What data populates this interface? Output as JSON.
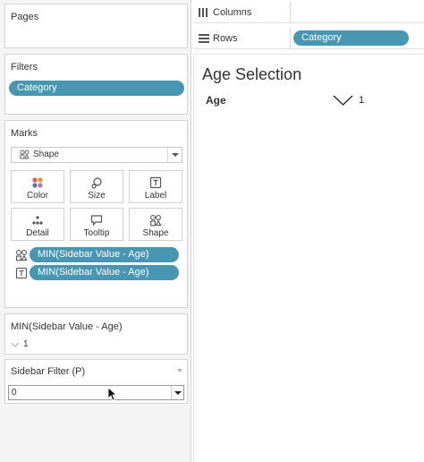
{
  "pages": {
    "title": "Pages"
  },
  "filters": {
    "title": "Filters",
    "items": [
      "Category"
    ]
  },
  "marks": {
    "title": "Marks",
    "mark_type": "Shape",
    "buttons": [
      {
        "label": "Color",
        "icon": "color-icon"
      },
      {
        "label": "Size",
        "icon": "size-icon"
      },
      {
        "label": "Label",
        "icon": "label-icon"
      },
      {
        "label": "Detail",
        "icon": "detail-icon"
      },
      {
        "label": "Tooltip",
        "icon": "tooltip-icon"
      },
      {
        "label": "Shape",
        "icon": "shape-icon"
      }
    ],
    "encodings": [
      {
        "type": "shape",
        "field": "MIN(Sidebar Value - Age)"
      },
      {
        "type": "label",
        "field": "MIN(Sidebar Value - Age)"
      }
    ]
  },
  "shape_legend": {
    "title": "MIN(Sidebar Value - Age)",
    "items": [
      {
        "value": "1"
      }
    ]
  },
  "parameter": {
    "title": "Sidebar Filter (P)",
    "value": "0"
  },
  "shelves": {
    "columns": {
      "label": "Columns",
      "pills": []
    },
    "rows": {
      "label": "Rows",
      "pills": [
        "Category"
      ]
    }
  },
  "view": {
    "title": "Age Selection",
    "header": "Age",
    "value": "1"
  },
  "colors": {
    "pill": "#4996b2",
    "panel": "#f4f4f4",
    "border": "#d4d4d4"
  }
}
